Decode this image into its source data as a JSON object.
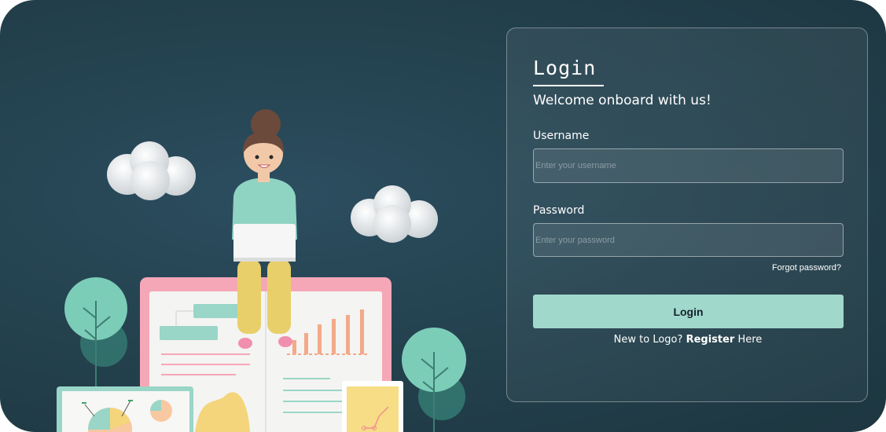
{
  "login": {
    "title": "Login",
    "subtitle": "Welcome onboard with us!",
    "username_label": "Username",
    "username_placeholder": "Enter your username",
    "password_label": "Password",
    "password_placeholder": "Enter your password",
    "forgot_label": "Forgot password?",
    "button_label": "Login",
    "register_prefix": "New to Logo? ",
    "register_link": "Register",
    "register_suffix": " Here"
  },
  "colors": {
    "background": "#24424f",
    "accent": "#a1d8cc",
    "text": "#ffffff"
  },
  "illustration": {
    "name": "woman-with-laptop-on-dashboard"
  }
}
